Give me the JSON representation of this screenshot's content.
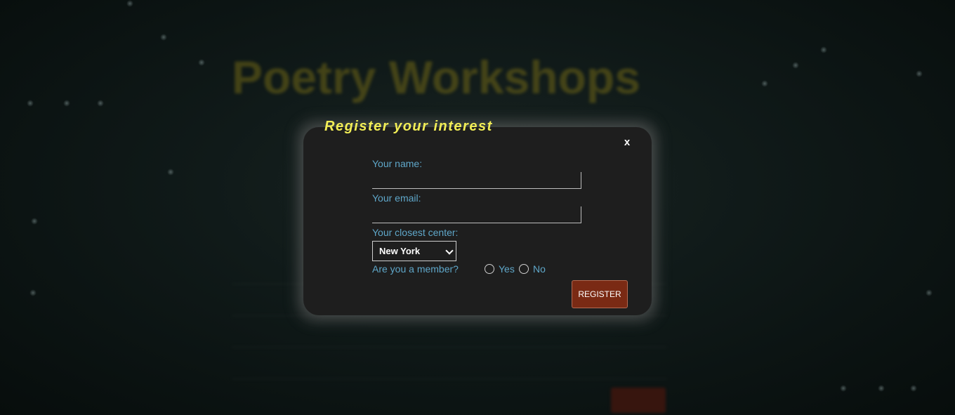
{
  "background": {
    "page_title": "Poetry Workshops"
  },
  "modal": {
    "title": "Register your interest",
    "close_label": "x",
    "name_label": "Your name:",
    "name_value": "",
    "email_label": "Your email:",
    "email_value": "",
    "center_label": "Your closest center:",
    "center_selected": "New York",
    "member_label": "Are you a member?",
    "member_options": [
      "Yes",
      "No"
    ],
    "register_label": "REGISTER"
  },
  "colors": {
    "title_yellow": "#f2ee56",
    "label_blue": "#5fa7c9",
    "register_button": "#7a2a14",
    "modal_background": "#1e1e1e"
  }
}
